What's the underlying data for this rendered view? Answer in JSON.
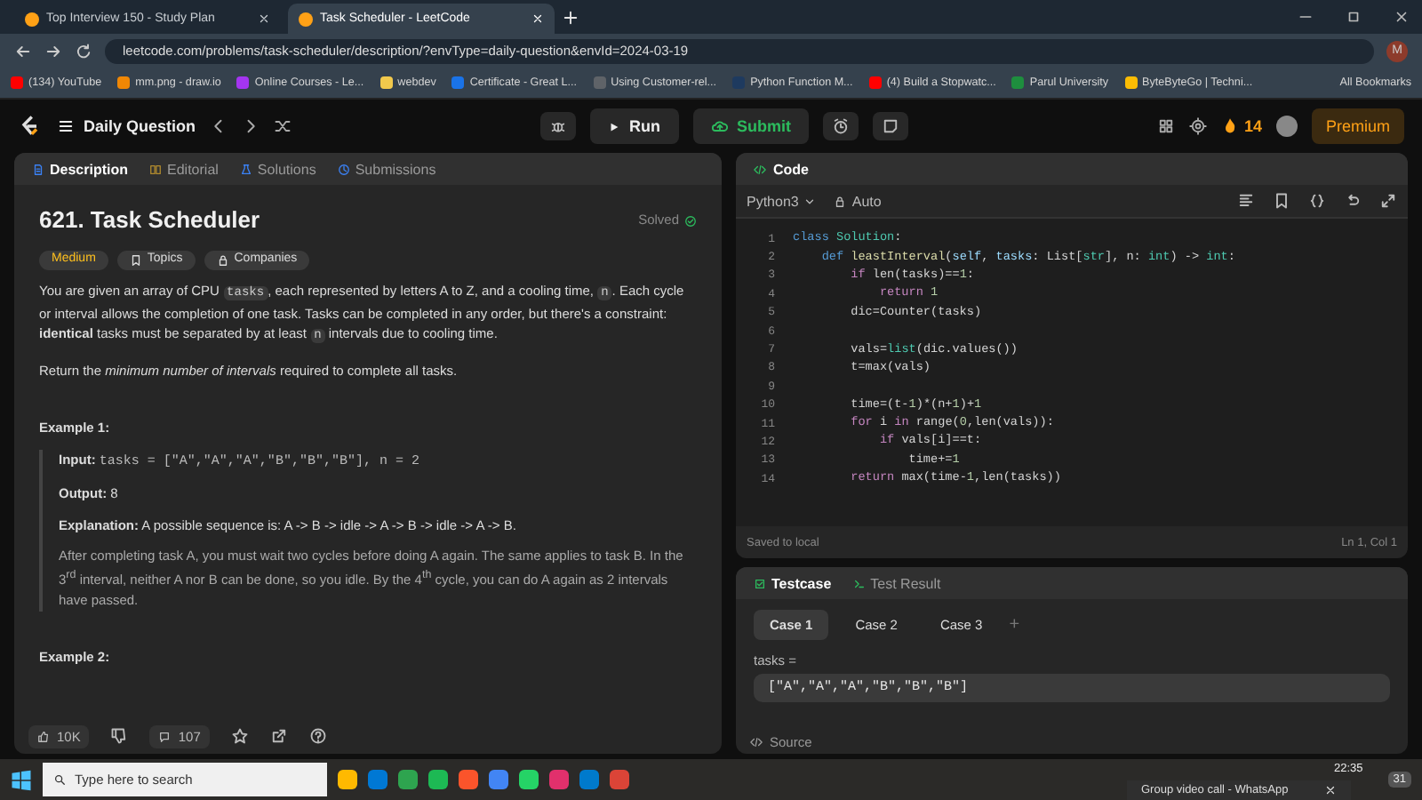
{
  "browser": {
    "tabs": [
      {
        "title": "Top Interview 150 - Study Plan",
        "selected": false
      },
      {
        "title": "Task Scheduler - LeetCode",
        "selected": true
      }
    ],
    "address": "leetcode.com/problems/task-scheduler/description/?envType=daily-question&envId=2024-03-19",
    "profile": "M",
    "bookmarks": [
      {
        "label": "(134) YouTube",
        "color": "#ff0000"
      },
      {
        "label": "mm.png - draw.io",
        "color": "#f08705"
      },
      {
        "label": "Online Courses - Le...",
        "color": "#a435f0"
      },
      {
        "label": "webdev",
        "color": "#f2c94c"
      },
      {
        "label": "Certificate - Great L...",
        "color": "#1a73e8"
      },
      {
        "label": "Using Customer-rel...",
        "color": "#5f6368"
      },
      {
        "label": "Python Function M...",
        "color": "#1e3a5f"
      },
      {
        "label": "(4) Build a Stopwatc...",
        "color": "#ff0000"
      },
      {
        "label": "Parul University",
        "color": "#1e8e3e"
      },
      {
        "label": "ByteByteGo | Techni...",
        "color": "#fbbc04"
      }
    ],
    "all_bookmarks": "All Bookmarks"
  },
  "header": {
    "list_title": "Daily Question",
    "run": "Run",
    "submit": "Submit",
    "streak": "14",
    "premium": "Premium"
  },
  "left_tabs": [
    {
      "label": "Description",
      "selected": true
    },
    {
      "label": "Editorial",
      "selected": false
    },
    {
      "label": "Solutions",
      "selected": false
    },
    {
      "label": "Submissions",
      "selected": false
    }
  ],
  "problem": {
    "title": "621. Task Scheduler",
    "status": "Solved",
    "difficulty": "Medium",
    "tags": [
      "Topics",
      "Companies"
    ],
    "paragraphs": [
      [
        {
          "kind": "text",
          "text": "You are given an array of CPU "
        },
        {
          "kind": "code",
          "text": "tasks"
        },
        {
          "kind": "text",
          "text": ", each represented by letters A to Z, and a cooling time, "
        },
        {
          "kind": "code",
          "text": "n"
        },
        {
          "kind": "text",
          "text": ". Each cycle or interval allows the completion of one task. Tasks can be completed in any order, but there's a constraint: **identical** tasks must be separated by at least "
        },
        {
          "kind": "code",
          "text": "n"
        },
        {
          "kind": "text",
          "text": " intervals due to cooling time."
        }
      ],
      [
        {
          "kind": "text",
          "text": "Return the *minimum number of intervals* required to complete all tasks."
        }
      ]
    ],
    "examples": [
      {
        "title": "Example 1:",
        "input_label": "Input:",
        "input": "tasks = [\"A\",\"A\",\"A\",\"B\",\"B\",\"B\"], n = 2",
        "output_label": "Output:",
        "output": "8",
        "explanation": "**Explanation:** A possible sequence is: A -> B -> idle -> A -> B -> idle -> A -> B.",
        "note": "After completing task A, you must wait two cycles before doing A again. The same applies to task B. In the 3$^{rd}$ interval, neither A nor B can be done, so you idle. By the 4$^{th}$ cycle, you can do A again as 2 intervals have passed."
      },
      {
        "title": "Example 2:"
      }
    ],
    "likes": "10K",
    "comments": "107"
  },
  "code": {
    "title": "Code",
    "language": "Python3",
    "mode": "Auto",
    "lines": [
      {
        "num": "1",
        "tokens": [
          {
            "kind": "kw",
            "text": "class"
          },
          {
            "kind": "type",
            "text": " Solution"
          },
          {
            "kind": "plain",
            "text": ":"
          }
        ]
      },
      {
        "num": "2",
        "tokens": [
          {
            "kind": "kw",
            "text": "    def"
          },
          {
            "kind": "fn",
            "text": " leastInterval"
          },
          {
            "kind": "plain",
            "text": "("
          },
          {
            "kind": "param",
            "text": "self"
          },
          {
            "kind": "plain",
            "text": ", "
          },
          {
            "kind": "param",
            "text": "tasks"
          },
          {
            "kind": "plain",
            "text": ": List["
          },
          {
            "kind": "type",
            "text": "str"
          },
          {
            "kind": "plain",
            "text": "], n: "
          },
          {
            "kind": "type",
            "text": "int"
          },
          {
            "kind": "plain",
            "text": ") -> "
          },
          {
            "kind": "type",
            "text": "int"
          },
          {
            "kind": "plain",
            "text": ":"
          }
        ]
      },
      {
        "num": "3",
        "tokens": [
          {
            "kind": "ctrl",
            "text": "        if"
          },
          {
            "kind": "plain",
            "text": " len(tasks)=="
          },
          {
            "kind": "num",
            "text": "1"
          },
          {
            "kind": "plain",
            "text": ":"
          }
        ]
      },
      {
        "num": "4",
        "tokens": [
          {
            "kind": "ctrl",
            "text": "            return"
          },
          {
            "kind": "num",
            "text": " 1"
          }
        ]
      },
      {
        "num": "5",
        "tokens": [
          {
            "kind": "plain",
            "text": "        dic=Counter(tasks)"
          }
        ]
      },
      {
        "num": "6"
      },
      {
        "num": "7",
        "tokens": [
          {
            "kind": "plain",
            "text": "        vals="
          },
          {
            "kind": "type",
            "text": "list"
          },
          {
            "kind": "plain",
            "text": "(dic.values())"
          }
        ]
      },
      {
        "num": "8",
        "tokens": [
          {
            "kind": "plain",
            "text": "        t=max(vals)"
          }
        ]
      },
      {
        "num": "9"
      },
      {
        "num": "10",
        "tokens": [
          {
            "kind": "plain",
            "text": "        time=(t-"
          },
          {
            "kind": "num",
            "text": "1"
          },
          {
            "kind": "plain",
            "text": ")*(n+"
          },
          {
            "kind": "num",
            "text": "1"
          },
          {
            "kind": "plain",
            "text": ")+"
          },
          {
            "kind": "num",
            "text": "1"
          }
        ]
      },
      {
        "num": "11",
        "tokens": [
          {
            "kind": "ctrl",
            "text": "        for"
          },
          {
            "kind": "plain",
            "text": " i "
          },
          {
            "kind": "ctrl",
            "text": "in"
          },
          {
            "kind": "plain",
            "text": " range("
          },
          {
            "kind": "num",
            "text": "0"
          },
          {
            "kind": "plain",
            "text": ",len(vals)):"
          }
        ]
      },
      {
        "num": "12",
        "tokens": [
          {
            "kind": "ctrl",
            "text": "            if"
          },
          {
            "kind": "plain",
            "text": " vals[i]==t:"
          }
        ]
      },
      {
        "num": "13",
        "tokens": [
          {
            "kind": "plain",
            "text": "                time+="
          },
          {
            "kind": "num",
            "text": "1"
          }
        ]
      },
      {
        "num": "14",
        "tokens": [
          {
            "kind": "ctrl",
            "text": "        return"
          },
          {
            "kind": "plain",
            "text": " max(time-"
          },
          {
            "kind": "num",
            "text": "1"
          },
          {
            "kind": "plain",
            "text": ",len(tasks))"
          }
        ]
      }
    ],
    "saved": "Saved to local",
    "cursor": "Ln 1, Col 1"
  },
  "testcase_tabs": [
    {
      "label": "Testcase",
      "selected": true
    },
    {
      "label": "Test Result",
      "selected": false
    }
  ],
  "cases": [
    {
      "label": "Case 1",
      "selected": true
    },
    {
      "label": "Case 2",
      "selected": false
    },
    {
      "label": "Case 3",
      "selected": false
    }
  ],
  "add_case": "+",
  "case_input": {
    "label": "tasks =",
    "value": "[\"A\",\"A\",\"A\",\"B\",\"B\",\"B\"]"
  },
  "source": "Source",
  "taskbar": {
    "search_placeholder": "Type here to search",
    "time": "22:35",
    "notification_count": "31",
    "toast": "Group video call - WhatsApp"
  }
}
